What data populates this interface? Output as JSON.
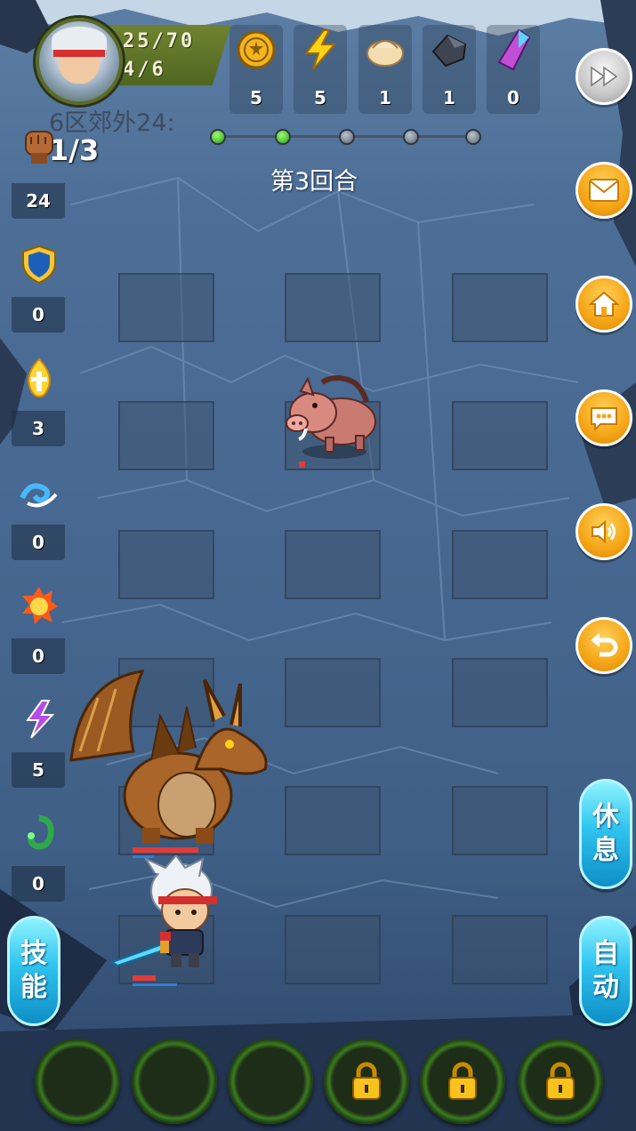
{
  "player": {
    "hp_text": "25/70",
    "ap_text": "4/6"
  },
  "resources": [
    {
      "icon": "gold-coin-icon",
      "count": "5"
    },
    {
      "icon": "lightning-icon",
      "count": "5"
    },
    {
      "icon": "dumpling-icon",
      "count": "1"
    },
    {
      "icon": "iron-ore-icon",
      "count": "1"
    },
    {
      "icon": "crystal-icon",
      "count": "0"
    }
  ],
  "stage": {
    "title": "6区郊外24:",
    "progress": "1/3",
    "round": "第3回合",
    "progress_dots": [
      1,
      1,
      0,
      0,
      0
    ]
  },
  "sidebar": [
    {
      "icon": "fist-icon",
      "count": "24"
    },
    {
      "icon": "shield-icon",
      "count": "0"
    },
    {
      "icon": "holy-flame-icon",
      "count": "3"
    },
    {
      "icon": "wave-icon",
      "count": "0"
    },
    {
      "icon": "fireball-icon",
      "count": "0"
    },
    {
      "icon": "purple-lightning-icon",
      "count": "5"
    },
    {
      "icon": "poison-ring-icon",
      "count": "0"
    }
  ],
  "buttons": {
    "rest": [
      "休",
      "息"
    ],
    "skill": [
      "技",
      "能"
    ],
    "auto": [
      "自",
      "动"
    ]
  },
  "skill_slots": [
    {
      "locked": false
    },
    {
      "locked": false
    },
    {
      "locked": false
    },
    {
      "locked": true
    },
    {
      "locked": true
    },
    {
      "locked": true
    }
  ],
  "colors": {
    "accent_orange": "#f5a516",
    "capsule_blue": "#2fc4ef",
    "hp_red": "#e23b3b"
  }
}
